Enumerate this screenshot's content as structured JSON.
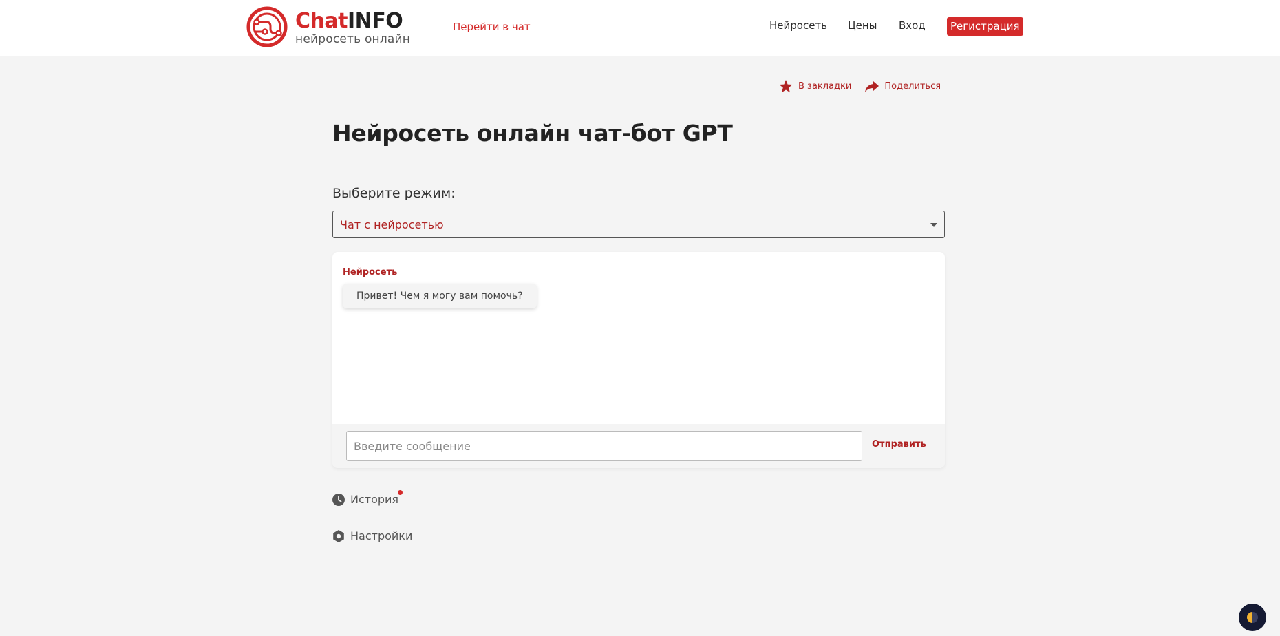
{
  "header": {
    "logo_brand_part1": "Chat",
    "logo_brand_part2": "INFO",
    "logo_subtitle": "нейросеть онлайн",
    "goto_chat": "Перейти в чат",
    "nav": {
      "neuro": "Нейросеть",
      "prices": "Цены",
      "login": "Вход",
      "register": "Регистрация"
    }
  },
  "actions": {
    "bookmark": "В закладки",
    "share": "Поделиться"
  },
  "main": {
    "title": "Нейросеть онлайн чат-бот GPT",
    "mode_label": "Выберите режим:",
    "mode_selected": "Чат с нейросетью"
  },
  "chat": {
    "author": "Нейросеть",
    "message": "Привет! Чем я могу вам помочь?",
    "input_placeholder": "Введите сообщение",
    "send": "Отправить"
  },
  "side": {
    "history": "История",
    "settings": "Настройки"
  },
  "colors": {
    "accent": "#d42a2a",
    "accent_dark": "#b02323",
    "background": "#f4f4f4",
    "theme_button": "#151a33"
  }
}
